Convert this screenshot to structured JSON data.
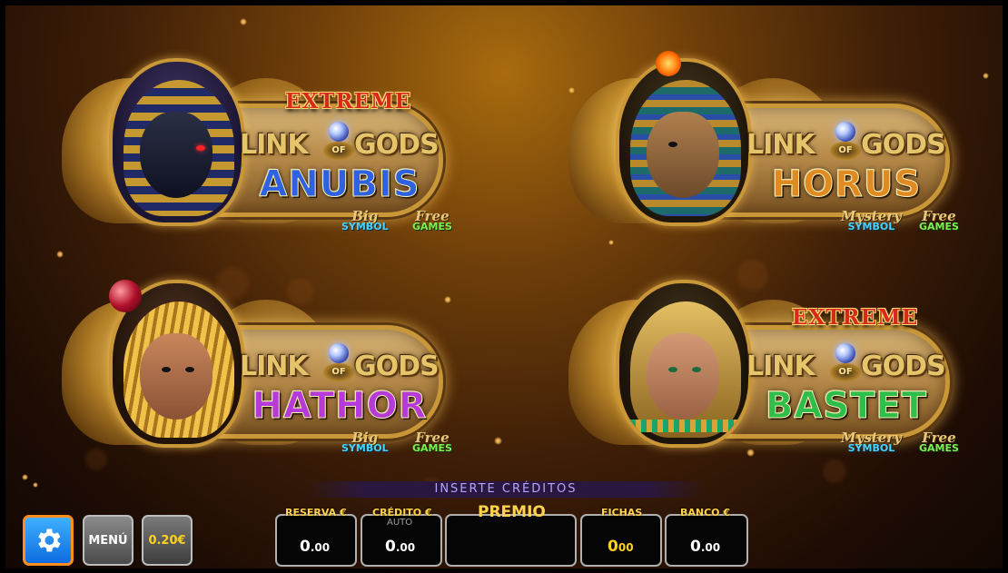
{
  "tiles": [
    {
      "id": "anubis",
      "extreme": "EXTREME",
      "link": "LINK",
      "of": "OF",
      "gods": "GODS",
      "name": "ANUBIS",
      "name_color": "#2f62e0",
      "feature1_script": "Big",
      "feature1_word": "SYMBOL",
      "feature2_script": "Free",
      "feature2_word": "GAMES"
    },
    {
      "id": "horus",
      "extreme": "",
      "link": "LINK",
      "of": "OF",
      "gods": "GODS",
      "name": "HORUS",
      "name_color": "#e08a24",
      "feature1_script": "Mystery",
      "feature1_word": "SYMBOL",
      "feature2_script": "Free",
      "feature2_word": "GAMES"
    },
    {
      "id": "hathor",
      "extreme": "",
      "link": "LINK",
      "of": "OF",
      "gods": "GODS",
      "name": "HATHOR",
      "name_color": "#b63ad8",
      "feature1_script": "Big",
      "feature1_word": "SYMBOL",
      "feature2_script": "Free",
      "feature2_word": "GAMES"
    },
    {
      "id": "bastet",
      "extreme": "EXTREME",
      "link": "LINK",
      "of": "OF",
      "gods": "GODS",
      "name": "BASTET",
      "name_color": "#2fbe4b",
      "feature1_script": "Mystery",
      "feature1_word": "SYMBOL",
      "feature2_script": "Free",
      "feature2_word": "GAMES"
    }
  ],
  "bar": {
    "insert_text": "INSERTE CRÉDITOS",
    "settings_icon": "gear-icon",
    "menu_label": "MENÚ",
    "bet_label": "0.20€",
    "reserva_label": "RESERVA €",
    "reserva_int": "0",
    "reserva_dec": ".00",
    "credito_label": "CRÉDITO €",
    "auto_label": "AUTO",
    "credito_int": "0",
    "credito_dec": ".00",
    "premio_label": "PREMIO",
    "fichas_label": "FICHAS",
    "fichas_int": "0",
    "fichas_dec": "00",
    "banco_label": "BANCO €",
    "banco_int": "0",
    "banco_dec": ".00"
  },
  "colors": {
    "accent": "#ffd34a",
    "settings_border": "#ff8e1f",
    "fichas_value": "#ffd21f"
  }
}
